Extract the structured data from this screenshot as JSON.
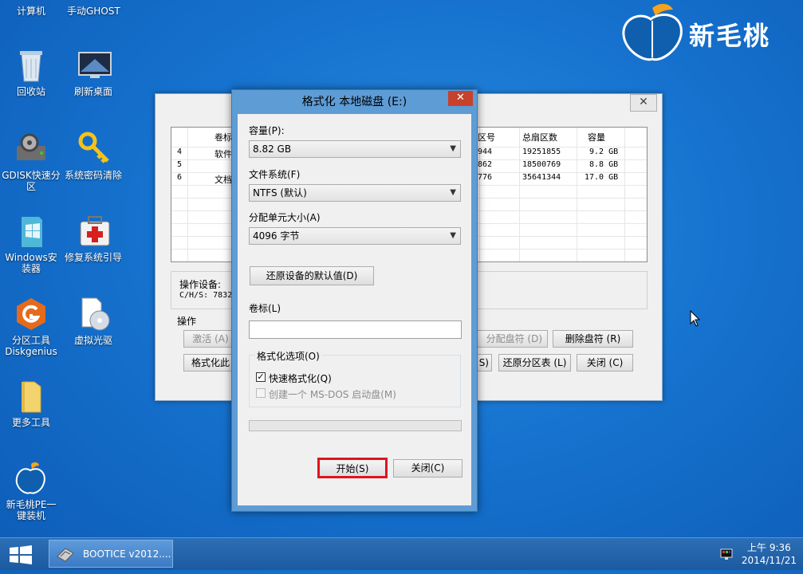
{
  "desktop": {
    "top_labels": [
      "计算机",
      "手动GHOST"
    ],
    "icons": [
      {
        "label": "回收站",
        "icon": "recycle-bin-icon"
      },
      {
        "label": "刷新桌面",
        "icon": "refresh-desktop-icon"
      },
      {
        "label": "GDISK快速分区",
        "icon": "gdisk-icon"
      },
      {
        "label": "系统密码清除",
        "icon": "key-icon"
      },
      {
        "label": "Windows安装器",
        "icon": "windows-installer-icon"
      },
      {
        "label": "修复系统引导",
        "icon": "first-aid-icon"
      },
      {
        "label": "分区工具Diskgenius",
        "icon": "diskgenius-icon"
      },
      {
        "label": "虚拟光驱",
        "icon": "virtual-cd-icon"
      },
      {
        "label": "更多工具",
        "icon": "folder-icon"
      },
      {
        "label": "新毛桃PE一键装机",
        "icon": "peach-installer-icon"
      }
    ]
  },
  "logo": {
    "text": "新毛桃"
  },
  "bootice": {
    "close_label": "✕",
    "table": {
      "headers": [
        "卷标",
        "区号",
        "总扇区数",
        "容量"
      ],
      "rows": [
        {
          "num": "4",
          "label": "软件",
          "sector": "944",
          "total": "19251855",
          "size": "9.2 GB"
        },
        {
          "num": "5",
          "label": "",
          "sector": "862",
          "total": "18500769",
          "size": "8.8 GB"
        },
        {
          "num": "6",
          "label": "文档",
          "sector": "776",
          "total": "35641344",
          "size": "17.0 GB"
        }
      ]
    },
    "device_label": "操作设备:",
    "chs_label": "C/H/S: 7832",
    "ops_label": "操作",
    "buttons": {
      "activate": "激活 (A)",
      "format": "格式化此",
      "assign": "分配盘符 (D)",
      "remove": "删除盘符 (R)",
      "s_suffix": "S)",
      "restore_table": "还原分区表 (L)",
      "close": "关闭 (C)"
    }
  },
  "format_dialog": {
    "title": "格式化 本地磁盘 (E:)",
    "close_glyph": "✕",
    "capacity_label": "容量(P):",
    "capacity_value": "8.82 GB",
    "fs_label": "文件系统(F)",
    "fs_value": "NTFS (默认)",
    "alloc_label": "分配单元大小(A)",
    "alloc_value": "4096 字节",
    "restore_defaults": "还原设备的默认值(D)",
    "volume_label": "卷标(L)",
    "volume_value": "",
    "options_label": "格式化选项(O)",
    "quick_format": "快速格式化(Q)",
    "quick_format_checked": true,
    "msdos": "创建一个 MS-DOS 启动盘(M)",
    "msdos_checked": false,
    "start_button": "开始(S)",
    "close_button": "关闭(C)",
    "progress": 0
  },
  "taskbar": {
    "app_label": "BOOTICE v2012....",
    "time": "上午 9:36",
    "date": "2014/11/21"
  },
  "colors": {
    "accent_highlight": "#e0141e",
    "dialog_frame": "#5e9cd6"
  }
}
